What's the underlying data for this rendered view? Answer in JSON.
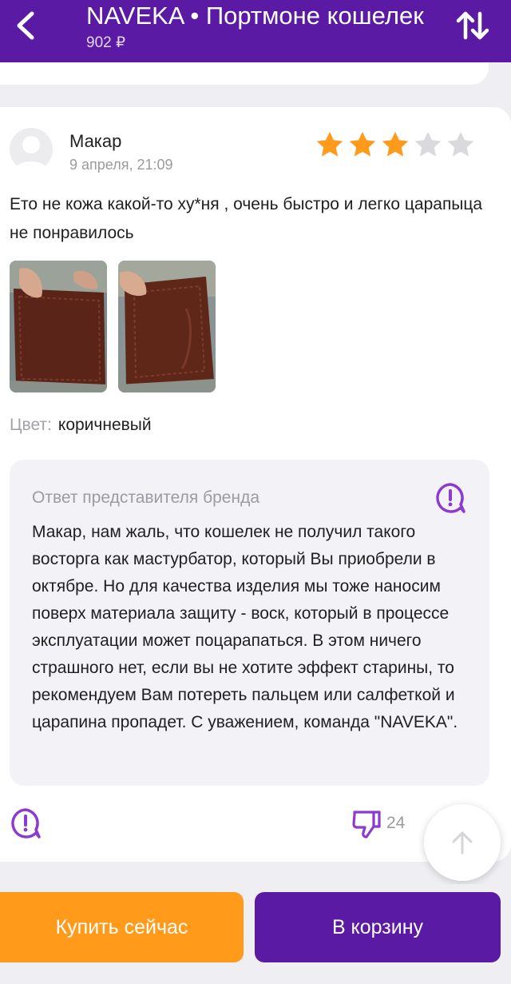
{
  "header": {
    "title": "NAVEKA • Портмоне кошелек",
    "price": "902 ₽",
    "icons": {
      "back": "chevron-left-icon",
      "sort": "sort-arrows-icon"
    }
  },
  "review": {
    "author": "Макар",
    "date": "9 апреля, 21:09",
    "rating": 3,
    "rating_max": 5,
    "text": "Ето не кожа какой-то ху*ня , очень быстро и легко царапыца не понравилось",
    "photos": [
      {
        "icon": "wallet-photo"
      },
      {
        "icon": "wallet-photo"
      }
    ],
    "color_label": "Цвет:",
    "color_value": "коричневый",
    "brand_reply": {
      "title": "Ответ представителя бренда",
      "text": "Макар, нам жаль, что кошелек не получил такого восторга как мастурбатор, который Вы приобрели в октябре. Но для качества изделия мы тоже наносим поверх материала защиту - воск, который в процессе эксплуатации может поцарапаться. В этом ничего страшного нет, если вы не хотите эффект старины, то рекомендуем Вам потереть пальцем или салфеткой и царапина пропадет. С уважением, команда \"NAVEKA\"."
    },
    "dislikes": "24"
  },
  "actions": {
    "buy_now": "Купить сейчас",
    "add_to_cart": "В корзину"
  },
  "colors": {
    "brand_purple": "#5b1aa3",
    "star_filled": "#ff9a1b",
    "star_empty": "#d9d9de",
    "buy_orange": "#ff9a1b",
    "icon_purple": "#8c3bd0"
  }
}
